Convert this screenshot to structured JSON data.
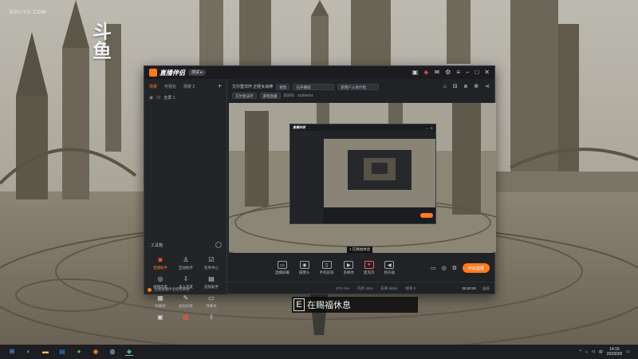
{
  "watermark": {
    "main": "斗鱼",
    "sub": "DOUYU.COM"
  },
  "subtitle": {
    "badge": "E",
    "text": "在赐福休息"
  },
  "app": {
    "brand": "直播伴侣",
    "badge": "测试 ▸",
    "tabs": [
      "场景",
      "可视化",
      "场景 2"
    ],
    "scene_name": "全屏 1",
    "stream_title": "艾尔登法环 正经女战神",
    "edit_label": "修改",
    "category": "已开播城",
    "announce": "新用户入场介绍",
    "tag1": "艾尔登法环",
    "tag2": "游戏直播",
    "room_label": "房间号",
    "room_id": "11256424",
    "preview_caption": "1 在赐福休息",
    "toolbox_label": "工具箱",
    "tools": [
      {
        "name": "tool-stream-assistant",
        "label": "直播助手"
      },
      {
        "name": "tool-fan-assistant",
        "label": "互动助手"
      },
      {
        "name": "tool-task-center",
        "label": "任务中心"
      },
      {
        "name": "tool-video-live",
        "label": "视频连麦"
      },
      {
        "name": "tool-multi-live",
        "label": "多人连麦"
      },
      {
        "name": "tool-game-assistant",
        "label": "竞技助手"
      },
      {
        "name": "tool-danmaku",
        "label": "弹幕姬"
      },
      {
        "name": "tool-virtual-image",
        "label": "虚拟形象"
      },
      {
        "name": "tool-gift-screen",
        "label": "弹幕机"
      },
      {
        "name": "tool-record",
        "label": "录制"
      },
      {
        "name": "tool-more",
        "label": "更多"
      },
      {
        "name": "tool-upload",
        "label": "上传"
      }
    ],
    "sidebar_foot": "主播直播伴侣使用教程",
    "bottom_tools": [
      "直播屏幕",
      "摄像头",
      "手机投屏",
      "多媒体",
      "麦克风",
      "扬声器"
    ],
    "start_live": "开始直播",
    "status": {
      "cpu": "CPU 0%",
      "mem": "内存 45%",
      "bitrate": "码率 0kb/s",
      "fps": "帧率 0",
      "time": "00:00:00",
      "quality": "画质"
    }
  },
  "taskbar": {
    "time": "14:15",
    "date": "2023/3/6"
  },
  "colors": {
    "accent": "#ff7a21",
    "window_bg": "#202226"
  }
}
